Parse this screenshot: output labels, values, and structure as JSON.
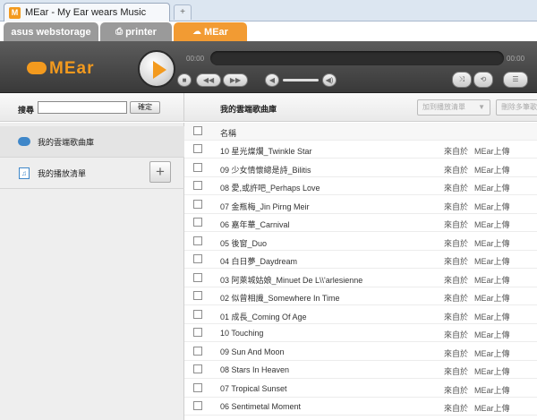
{
  "browser": {
    "tab_title": "MEar - My Ear wears Music",
    "favicon": "M",
    "new_tab_symbol": "+"
  },
  "app_tabs": {
    "storage": "asus webstorage",
    "printer": "printer",
    "mear": "MEar"
  },
  "player": {
    "logo": "MEar",
    "time_elapsed": "00:00",
    "time_total": "00:00",
    "stop_symbol": "■",
    "prev_symbol": "◀◀",
    "next_symbol": "▶▶",
    "vol_low_symbol": "◀",
    "vol_high_symbol": "◀)",
    "shuffle_symbol": "⤨",
    "repeat_symbol": "⟲",
    "list_symbol": "☰"
  },
  "toolbar": {
    "search_label": "搜尋",
    "search_value": "",
    "confirm_label": "確定",
    "library_title": "我的雲端歌曲庫",
    "add_playlist_label": "加到播放清單",
    "add_playlist_caret": "▼",
    "delete_label": "刪除多筆歌"
  },
  "sidebar": {
    "library_label": "我的雲端歌曲庫",
    "playlist_label": "我的播放清單",
    "playlist_icon": "♫",
    "add_symbol": "+"
  },
  "table": {
    "name_header": "名稱",
    "rows": [
      {
        "name": "10 星光燦爛_Twinkle Star",
        "src": "來自於",
        "owner": "MEar上傳"
      },
      {
        "name": "09 少女情懷總是詩_Bilitis",
        "src": "來自於",
        "owner": "MEar上傳"
      },
      {
        "name": "08 愛,或許吧_Perhaps Love",
        "src": "來自於",
        "owner": "MEar上傳"
      },
      {
        "name": "07 金瓶梅_Jin Pirng Meir",
        "src": "來自於",
        "owner": "MEar上傳"
      },
      {
        "name": "06 嘉年華_Carnival",
        "src": "來自於",
        "owner": "MEar上傳"
      },
      {
        "name": "05 後窗_Duo",
        "src": "來自於",
        "owner": "MEar上傳"
      },
      {
        "name": "04 白日夢_Daydream",
        "src": "來自於",
        "owner": "MEar上傳"
      },
      {
        "name": "03 阿萊城姑娘_Minuet De L\\\\'arlesienne",
        "src": "來自於",
        "owner": "MEar上傳"
      },
      {
        "name": "02 似曾相識_Somewhere In Time",
        "src": "來自於",
        "owner": "MEar上傳"
      },
      {
        "name": "01 成長_Coming Of Age",
        "src": "來自於",
        "owner": "MEar上傳"
      },
      {
        "name": "10 Touching",
        "src": "來自於",
        "owner": "MEar上傳"
      },
      {
        "name": "09 Sun And Moon",
        "src": "來自於",
        "owner": "MEar上傳"
      },
      {
        "name": "08 Stars In Heaven",
        "src": "來自於",
        "owner": "MEar上傳"
      },
      {
        "name": "07 Tropical Sunset",
        "src": "來自於",
        "owner": "MEar上傳"
      },
      {
        "name": "06 Sentimetal Moment",
        "src": "來自於",
        "owner": "MEar上傳"
      }
    ]
  },
  "colors": {
    "accent": "#f39a1e",
    "player_bg": "#474747",
    "sidebar_bg": "#eeeeee",
    "cloud_icon": "#3f87c9"
  }
}
